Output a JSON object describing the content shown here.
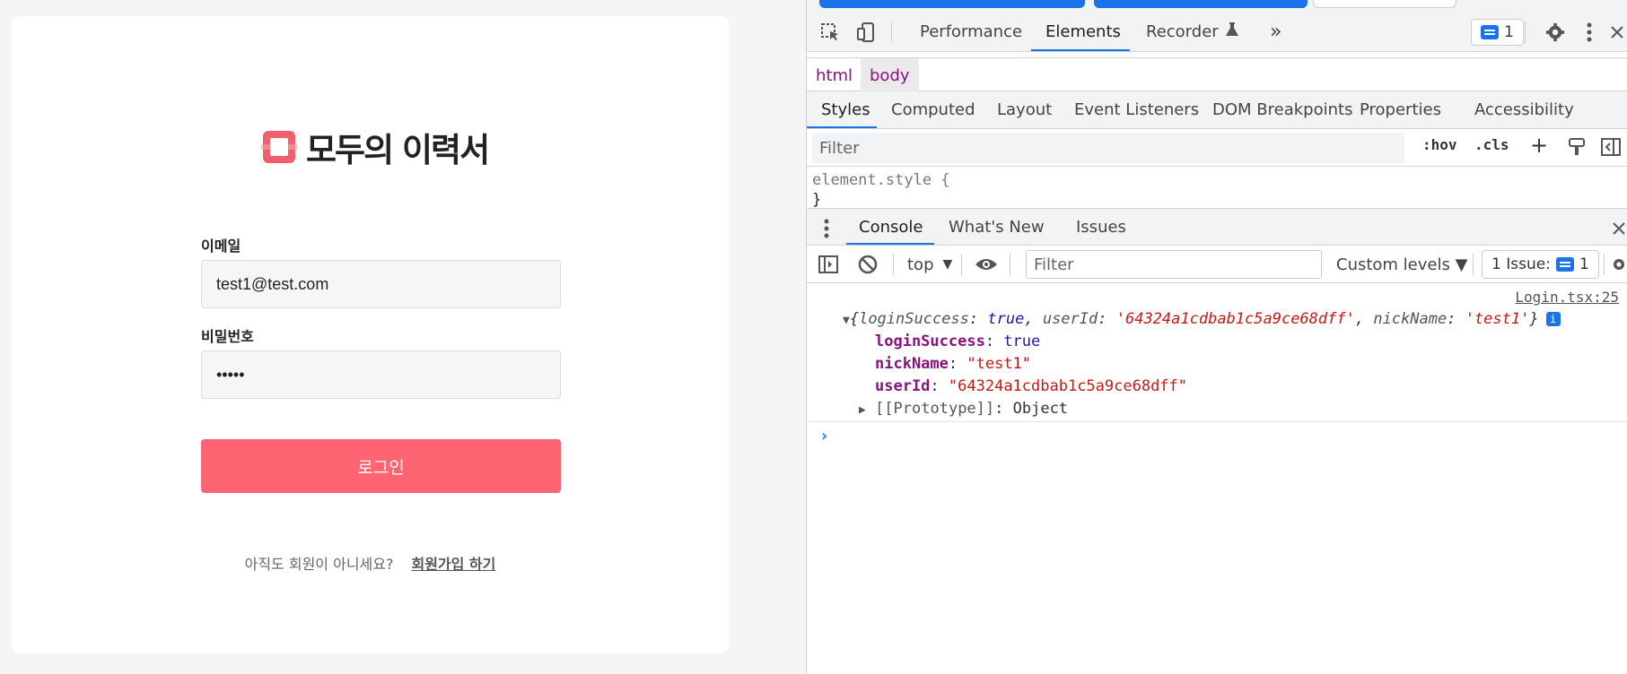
{
  "app": {
    "logo_text": "모두의 이력서",
    "email_label": "이메일",
    "email_value": "test1@test.com",
    "password_label": "비밀번호",
    "password_value": "•••••",
    "login_button": "로그인",
    "signup_question": "아직도 회원이 아니세요?",
    "signup_link": "회원가입 하기"
  },
  "devtools": {
    "main_tabs": [
      "Performance",
      "Elements",
      "Recorder",
      "»"
    ],
    "active_main_tab": "Elements",
    "issues_count": "1",
    "breadcrumbs": [
      "html",
      "body"
    ],
    "style_tabs": [
      "Styles",
      "Computed",
      "Layout",
      "Event Listeners",
      "DOM Breakpoints",
      "Properties",
      "Accessibility"
    ],
    "styles_filter_placeholder": "Filter",
    "hov": ":hov",
    "cls": ".cls",
    "plus": "+",
    "element_style_open": "element.style {",
    "element_style_close": "}",
    "drawer_tabs": [
      "Console",
      "What's New",
      "Issues"
    ],
    "console_context": "top",
    "console_filter_placeholder": "Filter",
    "levels": "Custom levels ▼",
    "issue_summary": "1 Issue:",
    "issue_summary_count": "1",
    "log": {
      "source": "Login.tsx:25",
      "summary": {
        "k1": "loginSuccess",
        "v1": "true",
        "k2": "userId",
        "v2": "'64324a1cdbab1c5a9ce68dff'",
        "k3": "nickName",
        "v3": "'test1'"
      },
      "props": [
        {
          "key": "loginSuccess",
          "value": "true"
        },
        {
          "key": "nickName",
          "value": "\"test1\""
        },
        {
          "key": "userId",
          "value": "\"64324a1cdbab1c5a9ce68dff\""
        }
      ],
      "prototype_key": "[[Prototype]]",
      "prototype_value": "Object"
    },
    "prompt": "›"
  }
}
